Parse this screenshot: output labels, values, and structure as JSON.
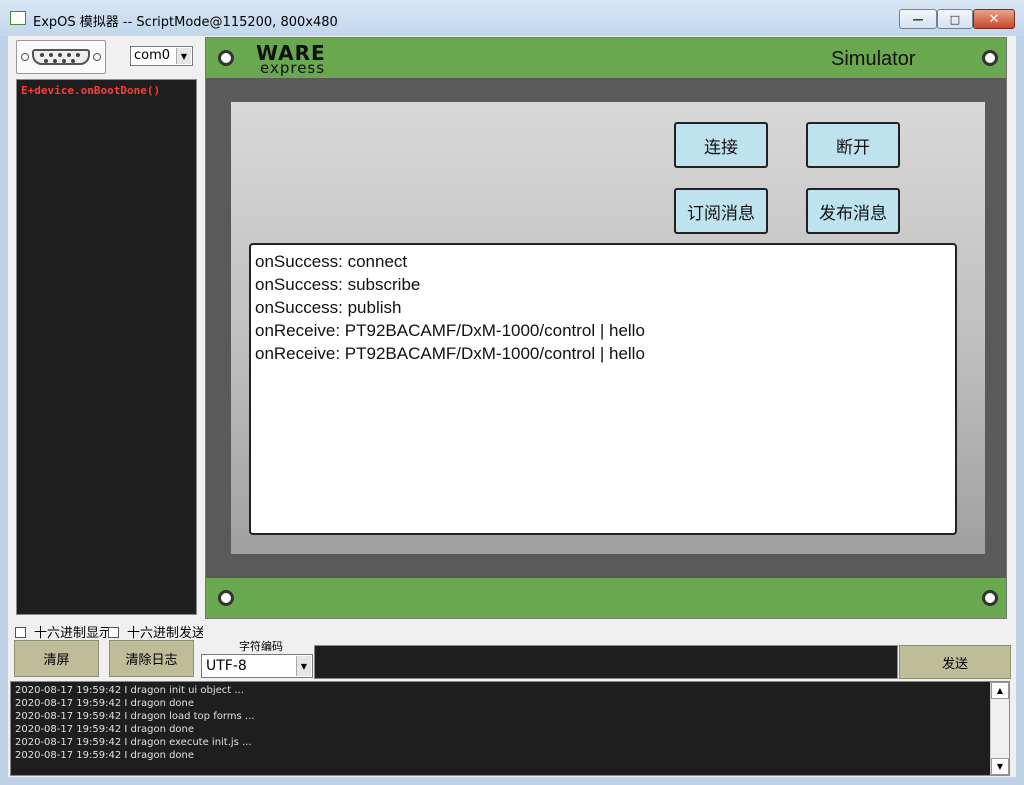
{
  "window": {
    "title": "ExpOS 模拟器 -- ScriptMode@115200, 800x480",
    "min_glyph": "—",
    "max_glyph": "□",
    "close_glyph": "✕"
  },
  "left_panel": {
    "port_select": "com0",
    "console_lines": [
      "E+device.onBootDone()"
    ],
    "hex_display_label": "十六进制显示",
    "hex_send_label": "十六进制发送",
    "clear_screen_label": "清屏",
    "clear_log_label": "清除日志"
  },
  "simulator": {
    "logo_top": "WARE",
    "logo_bottom": "express",
    "title": "Simulator",
    "buttons": {
      "connect": "连接",
      "disconnect": "断开",
      "subscribe": "订阅消息",
      "publish": "发布消息"
    },
    "log_lines": [
      "onSuccess: connect",
      "onSuccess: subscribe",
      "onSuccess: publish",
      "onReceive: PT92BACAMF/DxM-1000/control | hello",
      "onReceive: PT92BACAMF/DxM-1000/control | hello"
    ]
  },
  "bottom_bar": {
    "encoding_label": "字符编码",
    "encoding_value": "UTF-8",
    "send_input_value": "",
    "send_label": "发送"
  },
  "system_log": [
    "2020-08-17 19:59:42 I dragon init ui object ...",
    "2020-08-17 19:59:42 I dragon done",
    "2020-08-17 19:59:42 I dragon load top forms ...",
    "2020-08-17 19:59:42 I dragon done",
    "2020-08-17 19:59:42 I dragon execute init.js ...",
    "2020-08-17 19:59:42 I dragon done"
  ]
}
